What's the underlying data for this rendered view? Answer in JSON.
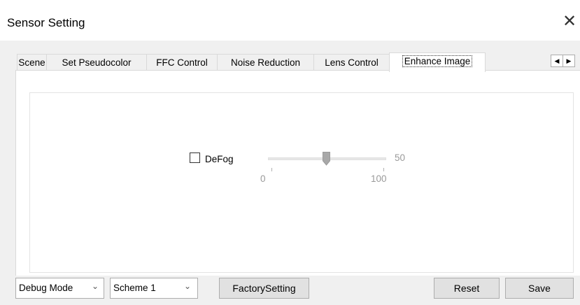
{
  "window": {
    "title": "Sensor Setting",
    "close_glyph": "✕",
    "close_icon": "close-icon"
  },
  "tabs": [
    {
      "label": "Scene"
    },
    {
      "label": "Set Pseudocolor"
    },
    {
      "label": "FFC Control"
    },
    {
      "label": "Noise Reduction"
    },
    {
      "label": "Lens Control"
    },
    {
      "label": "Enhance Image",
      "active": true
    }
  ],
  "tab_scroll": {
    "left_glyph": "◀",
    "right_glyph": "▶"
  },
  "defog": {
    "label": "DeFog",
    "checked": false,
    "value": "50",
    "min_label": "0",
    "max_label": "100",
    "slider_fraction": 0.5
  },
  "footer": {
    "mode_value": "Debug Mode",
    "scheme_value": "Scheme 1",
    "chevron": "⌄",
    "factory_label": "FactorySetting",
    "reset_label": "Reset",
    "save_label": "Save"
  },
  "colors": {
    "thumb": "#a8a8a8",
    "accent": "#0078d7"
  }
}
